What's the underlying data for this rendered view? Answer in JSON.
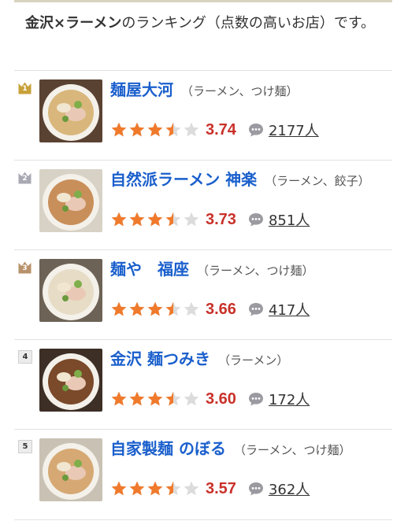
{
  "heading": {
    "bold": "金沢×ラーメン",
    "rest": "のランキング（点数の高いお店）です。"
  },
  "items": [
    {
      "rank": "1",
      "name": "麺屋大河",
      "genre": "（ラーメン、つけ麺）",
      "score": 3.74,
      "score_text": "3.74",
      "reviews": "2177人",
      "crown": "gold",
      "crown_color": "#c8a13a"
    },
    {
      "rank": "2",
      "name": "自然派ラーメン 神楽",
      "genre": "（ラーメン、餃子）",
      "score": 3.73,
      "score_text": "3.73",
      "reviews": "851人",
      "crown": "silver",
      "crown_color": "#a9a9b3"
    },
    {
      "rank": "3",
      "name": "麺や　福座",
      "genre": "（ラーメン、つけ麺）",
      "score": 3.66,
      "score_text": "3.66",
      "reviews": "417人",
      "crown": "bronze",
      "crown_color": "#b8926a"
    },
    {
      "rank": "4",
      "name": "金沢 麺つみき",
      "genre": "（ラーメン）",
      "score": 3.6,
      "score_text": "3.60",
      "reviews": "172人",
      "crown": "none",
      "crown_color": ""
    },
    {
      "rank": "5",
      "name": "自家製麺 のぼる",
      "genre": "（ラーメン、つけ麺）",
      "score": 3.57,
      "score_text": "3.57",
      "reviews": "362人",
      "crown": "none",
      "crown_color": ""
    }
  ],
  "icons": {
    "crown": "crown-icon",
    "star": "star-icon",
    "comment": "comment-bubble-icon"
  },
  "colors": {
    "link": "#1a5fcc",
    "score": "#c8312a",
    "star_filled": "#f07a2c",
    "star_empty": "#dcdcdc"
  }
}
